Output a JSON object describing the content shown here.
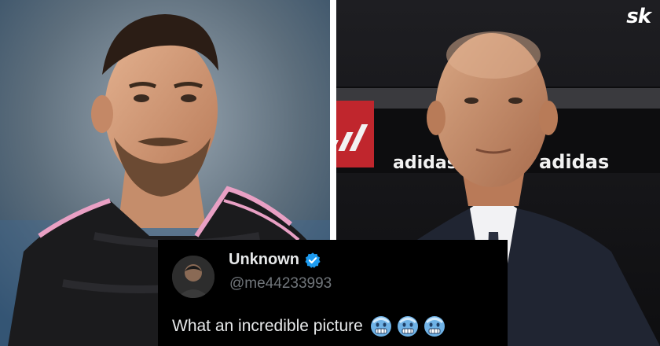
{
  "brand": {
    "logo_text": "sk"
  },
  "photos": [
    {
      "subject": "player-in-black-and-pink-kit",
      "icon": "adidas-logo"
    },
    {
      "subject": "coach-in-suit",
      "background_text": [
        "adidas",
        "adidas"
      ]
    }
  ],
  "tweet": {
    "display_name": "Unknown",
    "handle": "@me44233993",
    "text": "What an incredible picture",
    "emojis": [
      "cold-face-emoji",
      "cold-face-emoji",
      "cold-face-emoji"
    ],
    "verified_color": "#1d9bf0"
  },
  "colors": {
    "kit_pink": "#f0a3c8",
    "tweet_bg": "#000000"
  }
}
